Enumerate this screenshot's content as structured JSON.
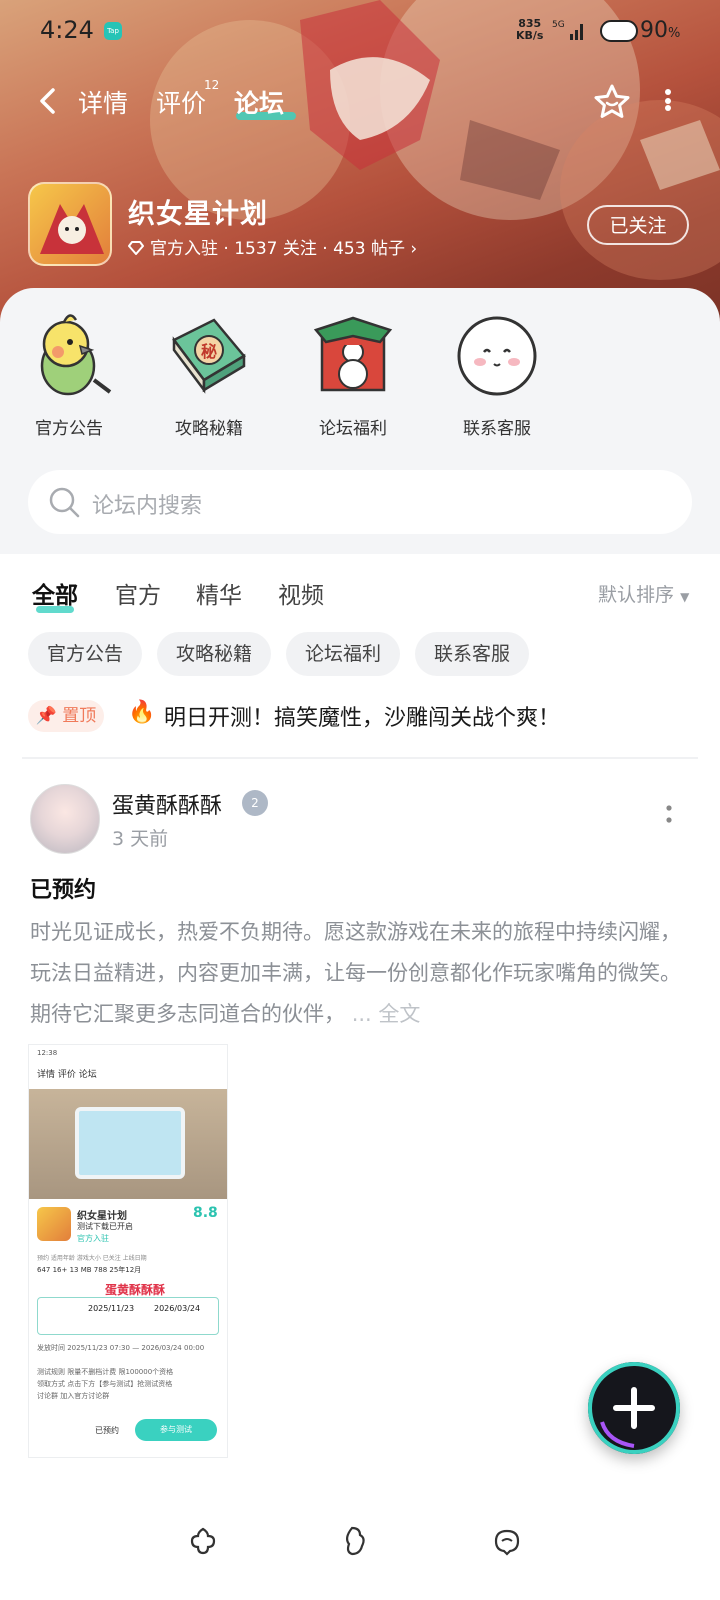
{
  "status": {
    "time": "4:24",
    "tap_badge": "Tap",
    "net_speed": "835",
    "net_unit": "KB/s",
    "signal": "5G",
    "battery": "90",
    "battery_unit": "%"
  },
  "nav": {
    "tabs": [
      {
        "label": "详情"
      },
      {
        "label": "评价",
        "count": "12"
      },
      {
        "label": "论坛"
      }
    ],
    "active_tab": "论坛"
  },
  "app": {
    "name": "织女星计划",
    "official": "官方入驻",
    "follows": "1537 关注",
    "posts": "453 帖子",
    "follow_button": "已关注"
  },
  "quick_links": [
    {
      "label": "官方公告",
      "icon": "cockatiel-icon"
    },
    {
      "label": "攻略秘籍",
      "icon": "guide-book-icon"
    },
    {
      "label": "论坛福利",
      "icon": "gift-icon"
    },
    {
      "label": "联系客服",
      "icon": "support-face-icon"
    }
  ],
  "search": {
    "placeholder": "论坛内搜索"
  },
  "filter": {
    "tabs": [
      "全部",
      "官方",
      "精华",
      "视频"
    ],
    "active": "全部",
    "sort": "默认排序"
  },
  "chips": [
    "官方公告",
    "攻略秘籍",
    "论坛福利",
    "联系客服"
  ],
  "pinned": {
    "badge": "置顶",
    "text": "明日开测！搞笑魔性，沙雕闯关战个爽！"
  },
  "post": {
    "author": "蛋黄酥酥酥",
    "level": "2",
    "time": "3 天前",
    "title": "已预约",
    "body": "时光见证成长，热爱不负期待。愿这款游戏在未来的旅程中持续闪耀，玩法日益精进，内容更加丰满，让每一份创意都化作玩家嘴角的微笑。期待它汇聚更多志同道合的伙伴，",
    "more": "... 全文",
    "screenshot": {
      "time": "12:38",
      "tabs": "详情 评价 论坛",
      "app_name": "织女星计划",
      "subtitle": "测试下载已开启",
      "official": "官方入驻",
      "score": "8.8",
      "stats_labels": "预约    适用年龄    游戏大小    已关注    上线日期",
      "stats_values": "647    16+    13 MB    788    25年12月",
      "watermark": "蛋黄酥酥酥",
      "start_date": "2025/11/23",
      "end_date": "2026/03/24",
      "release": "发放时间  2025/11/23 07:30 — 2026/03/24 00:00",
      "rule": "测试规则  限量不删档计费 限100000个资格",
      "claim": "领取方式  点击下方【参与测试】抢测试资格",
      "group": "讨论群    加入官方讨论群",
      "reserved": "已预约",
      "join": "参与测试"
    }
  },
  "colors": {
    "accent": "#3ad1c0",
    "pin": "#f07a5a"
  }
}
